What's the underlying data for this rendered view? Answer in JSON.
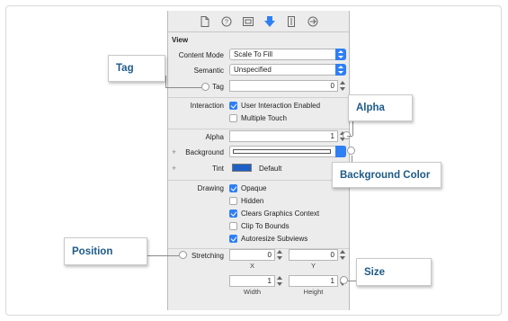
{
  "toolbar": {
    "icons": [
      "file-icon",
      "help-icon",
      "identity-icon",
      "attributes-icon",
      "size-icon",
      "connections-icon"
    ]
  },
  "view": {
    "section_title": "View",
    "content_mode_label": "Content Mode",
    "content_mode_value": "Scale To Fill",
    "semantic_label": "Semantic",
    "semantic_value": "Unspecified",
    "tag_label": "Tag",
    "tag_value": "0",
    "interaction_label": "Interaction",
    "user_interaction_label": "User Interaction Enabled",
    "multiple_touch_label": "Multiple Touch",
    "alpha_label": "Alpha",
    "alpha_value": "1",
    "background_label": "Background",
    "tint_label": "Tint",
    "tint_value": "Default",
    "drawing_label": "Drawing",
    "opaque_label": "Opaque",
    "hidden_label": "Hidden",
    "clears_label": "Clears Graphics Context",
    "clip_label": "Clip To Bounds",
    "autoresize_label": "Autoresize Subviews",
    "stretching_label": "Stretching",
    "x_value": "0",
    "y_value": "0",
    "x_label": "X",
    "y_label": "Y",
    "width_value": "1",
    "height_value": "1",
    "width_label": "Width",
    "height_label": "Height"
  },
  "checkboxes": {
    "user_interaction": true,
    "multiple_touch": false,
    "opaque": true,
    "hidden": false,
    "clears": true,
    "clip": false,
    "autoresize": true
  },
  "callouts": {
    "tag": "Tag",
    "alpha": "Alpha",
    "background_color": "Background Color",
    "position": "Position",
    "size": "Size"
  },
  "colors": {
    "accent": "#2f7ff4",
    "callout_text": "#1d5a87",
    "tint": "#1f5fc5"
  }
}
